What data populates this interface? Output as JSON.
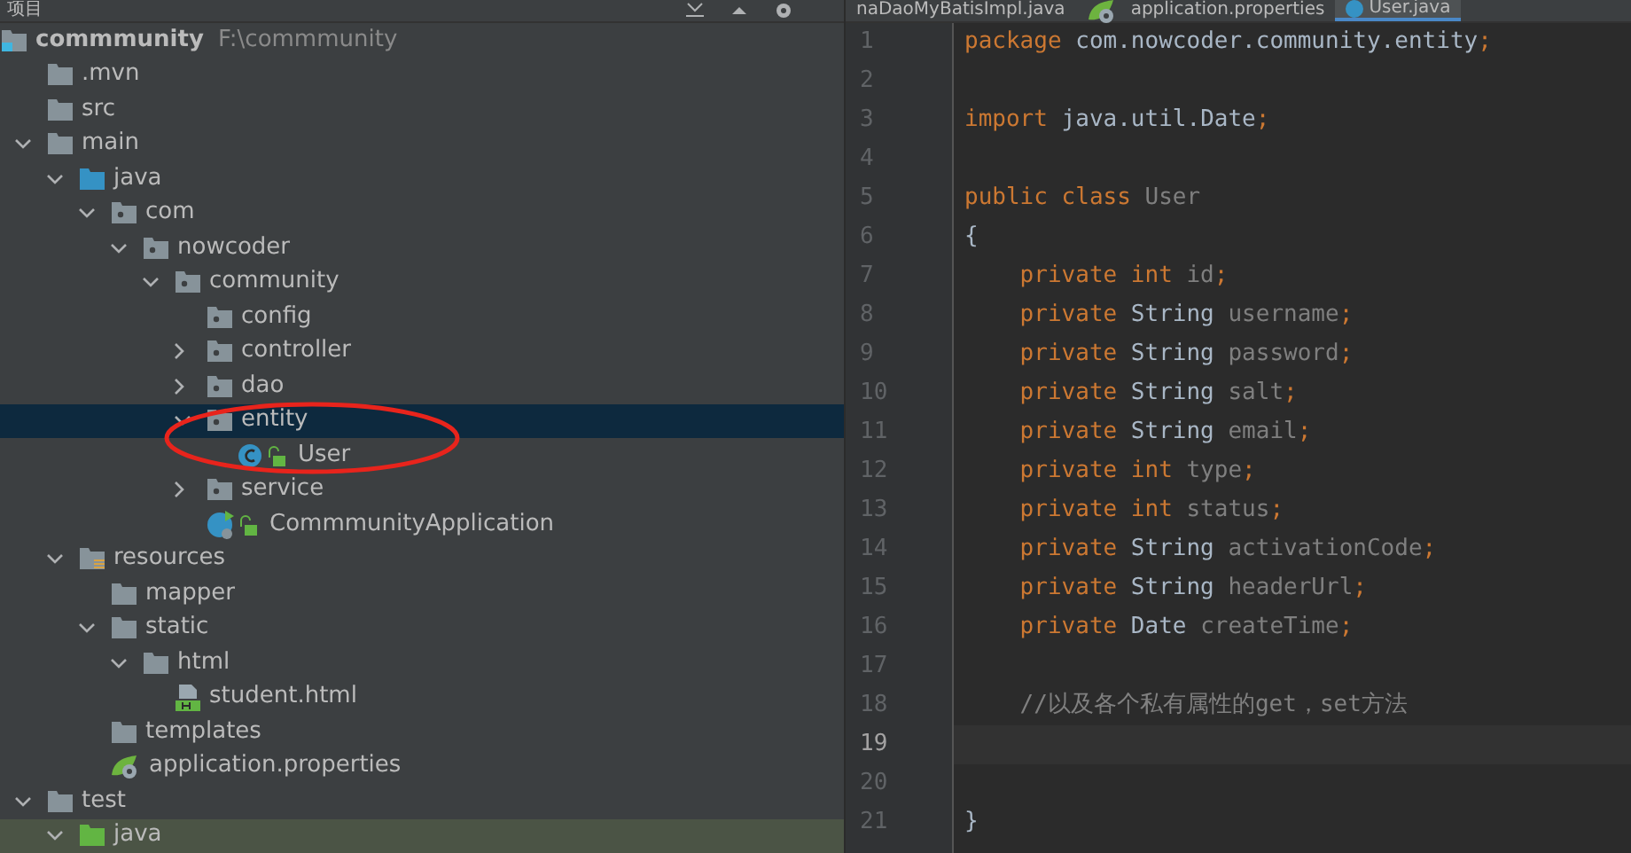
{
  "project_panel": {
    "title": "项目",
    "tree": [
      {
        "label": "commmunity",
        "path": "F:\\commmunity",
        "kind": "module",
        "selected": false,
        "children": [
          {
            "label": ".mvn",
            "kind": "folder",
            "selected": false
          },
          {
            "label": "src",
            "kind": "folder",
            "selected": false
          },
          {
            "label": "main",
            "kind": "folder",
            "selected": false,
            "expanded": true,
            "children": [
              {
                "label": "java",
                "kind": "source-folder",
                "selected": false,
                "expanded": true,
                "children": [
                  {
                    "label": "com",
                    "kind": "package",
                    "selected": false,
                    "expanded": true,
                    "children": [
                      {
                        "label": "nowcoder",
                        "kind": "package",
                        "selected": false,
                        "expanded": true,
                        "children": [
                          {
                            "label": "community",
                            "kind": "package",
                            "selected": false,
                            "expanded": true,
                            "children": [
                              {
                                "label": "config",
                                "kind": "package",
                                "selected": false
                              },
                              {
                                "label": "controller",
                                "kind": "package",
                                "selected": false,
                                "expanded": false
                              },
                              {
                                "label": "dao",
                                "kind": "package",
                                "selected": false,
                                "expanded": false
                              },
                              {
                                "label": "entity",
                                "kind": "package",
                                "selected": true,
                                "expanded": true,
                                "children": [
                                  {
                                    "label": "User",
                                    "kind": "class",
                                    "selected": false
                                  }
                                ]
                              },
                              {
                                "label": "service",
                                "kind": "package",
                                "selected": false,
                                "expanded": false
                              },
                              {
                                "label": "CommmunityApplication",
                                "kind": "app-class",
                                "selected": false
                              }
                            ]
                          }
                        ]
                      }
                    ]
                  }
                ]
              },
              {
                "label": "resources",
                "kind": "resources-folder",
                "selected": false,
                "expanded": true,
                "children": [
                  {
                    "label": "mapper",
                    "kind": "folder",
                    "selected": false
                  },
                  {
                    "label": "static",
                    "kind": "folder",
                    "selected": false,
                    "expanded": true,
                    "children": [
                      {
                        "label": "html",
                        "kind": "folder",
                        "selected": false,
                        "expanded": true,
                        "children": [
                          {
                            "label": "student.html",
                            "kind": "html",
                            "selected": false
                          }
                        ]
                      }
                    ]
                  },
                  {
                    "label": "templates",
                    "kind": "folder",
                    "selected": false
                  },
                  {
                    "label": "application.properties",
                    "kind": "properties",
                    "selected": false
                  }
                ]
              }
            ]
          },
          {
            "label": "test",
            "kind": "folder",
            "selected": false,
            "expanded": true,
            "children": [
              {
                "label": "java",
                "kind": "test-folder",
                "selected": false,
                "highlighted": true,
                "expanded": true
              }
            ]
          }
        ]
      }
    ],
    "highlight_ellipse": true
  },
  "editor": {
    "tabs": [
      {
        "label": "naDaoMyBatisImpl.java",
        "kind": "java",
        "selected": false
      },
      {
        "label": "application.properties",
        "kind": "properties",
        "selected": false
      },
      {
        "label": "User.java",
        "kind": "class",
        "selected": true
      }
    ],
    "lines": [
      {
        "number": "1",
        "current": false,
        "tokens": [
          {
            "kind": "keyword",
            "text": "package "
          },
          {
            "kind": "plain",
            "text": "com.nowcoder.community.entity"
          },
          {
            "kind": "keyword",
            "text": ";"
          }
        ]
      },
      {
        "number": "2",
        "current": false
      },
      {
        "number": "3",
        "current": false,
        "tokens": [
          {
            "kind": "keyword",
            "text": "import "
          },
          {
            "kind": "plain",
            "text": "java.util.Date"
          },
          {
            "kind": "keyword",
            "text": ";"
          }
        ]
      },
      {
        "number": "4",
        "current": false
      },
      {
        "number": "5",
        "current": false,
        "tokens": [
          {
            "kind": "keyword",
            "text": "public class "
          },
          {
            "kind": "unused",
            "text": "User"
          }
        ]
      },
      {
        "number": "6",
        "current": false,
        "tokens": [
          {
            "kind": "plain",
            "text": "{"
          }
        ]
      },
      {
        "number": "7",
        "current": false,
        "tokens": [
          {
            "kind": "keyword",
            "text": "    private int "
          },
          {
            "kind": "unused",
            "text": "id"
          },
          {
            "kind": "keyword",
            "text": ";"
          }
        ]
      },
      {
        "number": "8",
        "current": false,
        "tokens": [
          {
            "kind": "keyword",
            "text": "    private "
          },
          {
            "kind": "plain",
            "text": "String "
          },
          {
            "kind": "unused",
            "text": "username"
          },
          {
            "kind": "keyword",
            "text": ";"
          }
        ]
      },
      {
        "number": "9",
        "current": false,
        "tokens": [
          {
            "kind": "keyword",
            "text": "    private "
          },
          {
            "kind": "plain",
            "text": "String "
          },
          {
            "kind": "unused",
            "text": "password"
          },
          {
            "kind": "keyword",
            "text": ";"
          }
        ]
      },
      {
        "number": "10",
        "current": false,
        "tokens": [
          {
            "kind": "keyword",
            "text": "    private "
          },
          {
            "kind": "plain",
            "text": "String "
          },
          {
            "kind": "unused",
            "text": "salt"
          },
          {
            "kind": "keyword",
            "text": ";"
          }
        ]
      },
      {
        "number": "11",
        "current": false,
        "tokens": [
          {
            "kind": "keyword",
            "text": "    private "
          },
          {
            "kind": "plain",
            "text": "String "
          },
          {
            "kind": "unused",
            "text": "email"
          },
          {
            "kind": "keyword",
            "text": ";"
          }
        ]
      },
      {
        "number": "12",
        "current": false,
        "tokens": [
          {
            "kind": "keyword",
            "text": "    private int "
          },
          {
            "kind": "unused",
            "text": "type"
          },
          {
            "kind": "keyword",
            "text": ";"
          }
        ]
      },
      {
        "number": "13",
        "current": false,
        "tokens": [
          {
            "kind": "keyword",
            "text": "    private int "
          },
          {
            "kind": "unused",
            "text": "status"
          },
          {
            "kind": "keyword",
            "text": ";"
          }
        ]
      },
      {
        "number": "14",
        "current": false,
        "tokens": [
          {
            "kind": "keyword",
            "text": "    private "
          },
          {
            "kind": "plain",
            "text": "String "
          },
          {
            "kind": "unused",
            "text": "activationCode"
          },
          {
            "kind": "keyword",
            "text": ";"
          }
        ]
      },
      {
        "number": "15",
        "current": false,
        "tokens": [
          {
            "kind": "keyword",
            "text": "    private "
          },
          {
            "kind": "plain",
            "text": "String "
          },
          {
            "kind": "unused",
            "text": "headerUrl"
          },
          {
            "kind": "keyword",
            "text": ";"
          }
        ]
      },
      {
        "number": "16",
        "current": false,
        "tokens": [
          {
            "kind": "keyword",
            "text": "    private "
          },
          {
            "kind": "plain",
            "text": "Date "
          },
          {
            "kind": "unused",
            "text": "createTime"
          },
          {
            "kind": "keyword",
            "text": ";"
          }
        ]
      },
      {
        "number": "17",
        "current": false
      },
      {
        "number": "18",
        "current": false,
        "tokens": [
          {
            "kind": "comment",
            "text": "    //以及各个私有属性的get，set方法"
          }
        ]
      },
      {
        "number": "19",
        "current": true
      },
      {
        "number": "20",
        "current": false
      },
      {
        "number": "21",
        "current": false,
        "tokens": [
          {
            "kind": "plain",
            "text": "}"
          }
        ]
      }
    ]
  }
}
